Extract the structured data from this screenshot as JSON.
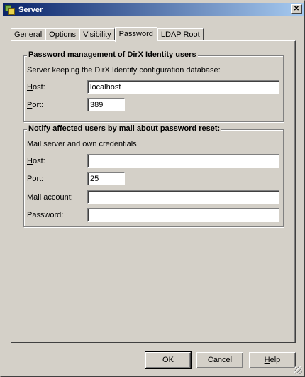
{
  "window": {
    "title": "Server",
    "close_symbol": "✕"
  },
  "tabs": [
    {
      "label": "General"
    },
    {
      "label": "Options"
    },
    {
      "label": "Visibility"
    },
    {
      "label": "Password"
    },
    {
      "label": "LDAP Root"
    }
  ],
  "password_group": {
    "title": "Password management of DirX Identity users",
    "description": "Server keeping the DirX Identity configuration database:",
    "host_label_first": "H",
    "host_label_rest": "ost:",
    "host_value": "localhost",
    "port_label_first": "P",
    "port_label_rest": "ort:",
    "port_value": "389"
  },
  "notify_group": {
    "title": "Notify affected users by mail about password reset:",
    "description": "Mail server and own credentials",
    "host_label_first": "H",
    "host_label_rest": "ost:",
    "host_value": "",
    "port_label_first": "P",
    "port_label_rest": "ort:",
    "port_value": "25",
    "mail_account_label": "Mail account:",
    "mail_account_value": "",
    "password_label": "Password:",
    "password_value": ""
  },
  "buttons": {
    "ok": "OK",
    "cancel": "Cancel",
    "help_first": "H",
    "help_rest": "elp"
  }
}
